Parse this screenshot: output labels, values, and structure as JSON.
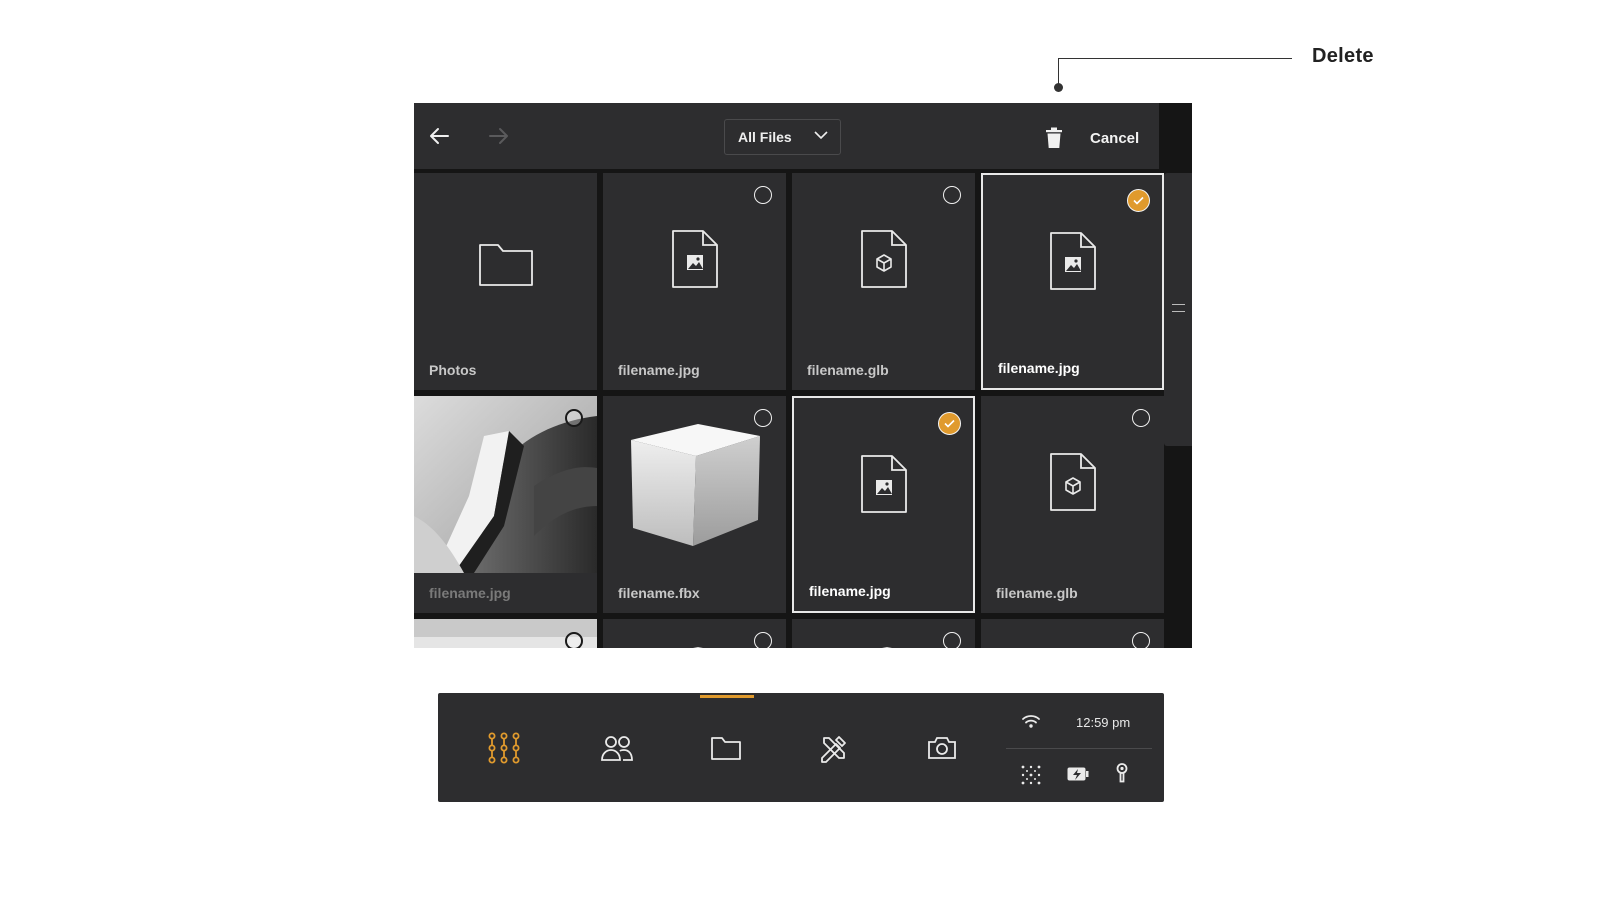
{
  "annotation": {
    "label": "Delete"
  },
  "toolbar": {
    "filter_value": "All Files",
    "cancel_label": "Cancel"
  },
  "files": [
    {
      "name": "Photos",
      "kind": "folder",
      "state": "none"
    },
    {
      "name": "filename.jpg",
      "kind": "image-file",
      "state": "unselected"
    },
    {
      "name": "filename.glb",
      "kind": "3d-file",
      "state": "unselected"
    },
    {
      "name": "filename.jpg",
      "kind": "image-file",
      "state": "selected"
    },
    {
      "name": "filename.jpg",
      "kind": "photo-thumbnail",
      "state": "unselected"
    },
    {
      "name": "filename.fbx",
      "kind": "cube-thumbnail",
      "state": "unselected"
    },
    {
      "name": "filename.jpg",
      "kind": "image-file",
      "state": "selected"
    },
    {
      "name": "filename.glb",
      "kind": "3d-file",
      "state": "unselected"
    }
  ],
  "dock": {
    "items": [
      "apps-icon",
      "people-icon",
      "folder-icon",
      "tools-icon",
      "camera-icon"
    ],
    "active": "folder-icon",
    "time": "12:59 pm",
    "status_icons": [
      "wifi-icon",
      "tracking-icon",
      "battery-charging-icon",
      "controller-icon"
    ]
  },
  "colors": {
    "accent": "#e09a2d",
    "panel": "#2d2d2f",
    "window_bg": "#151515"
  }
}
